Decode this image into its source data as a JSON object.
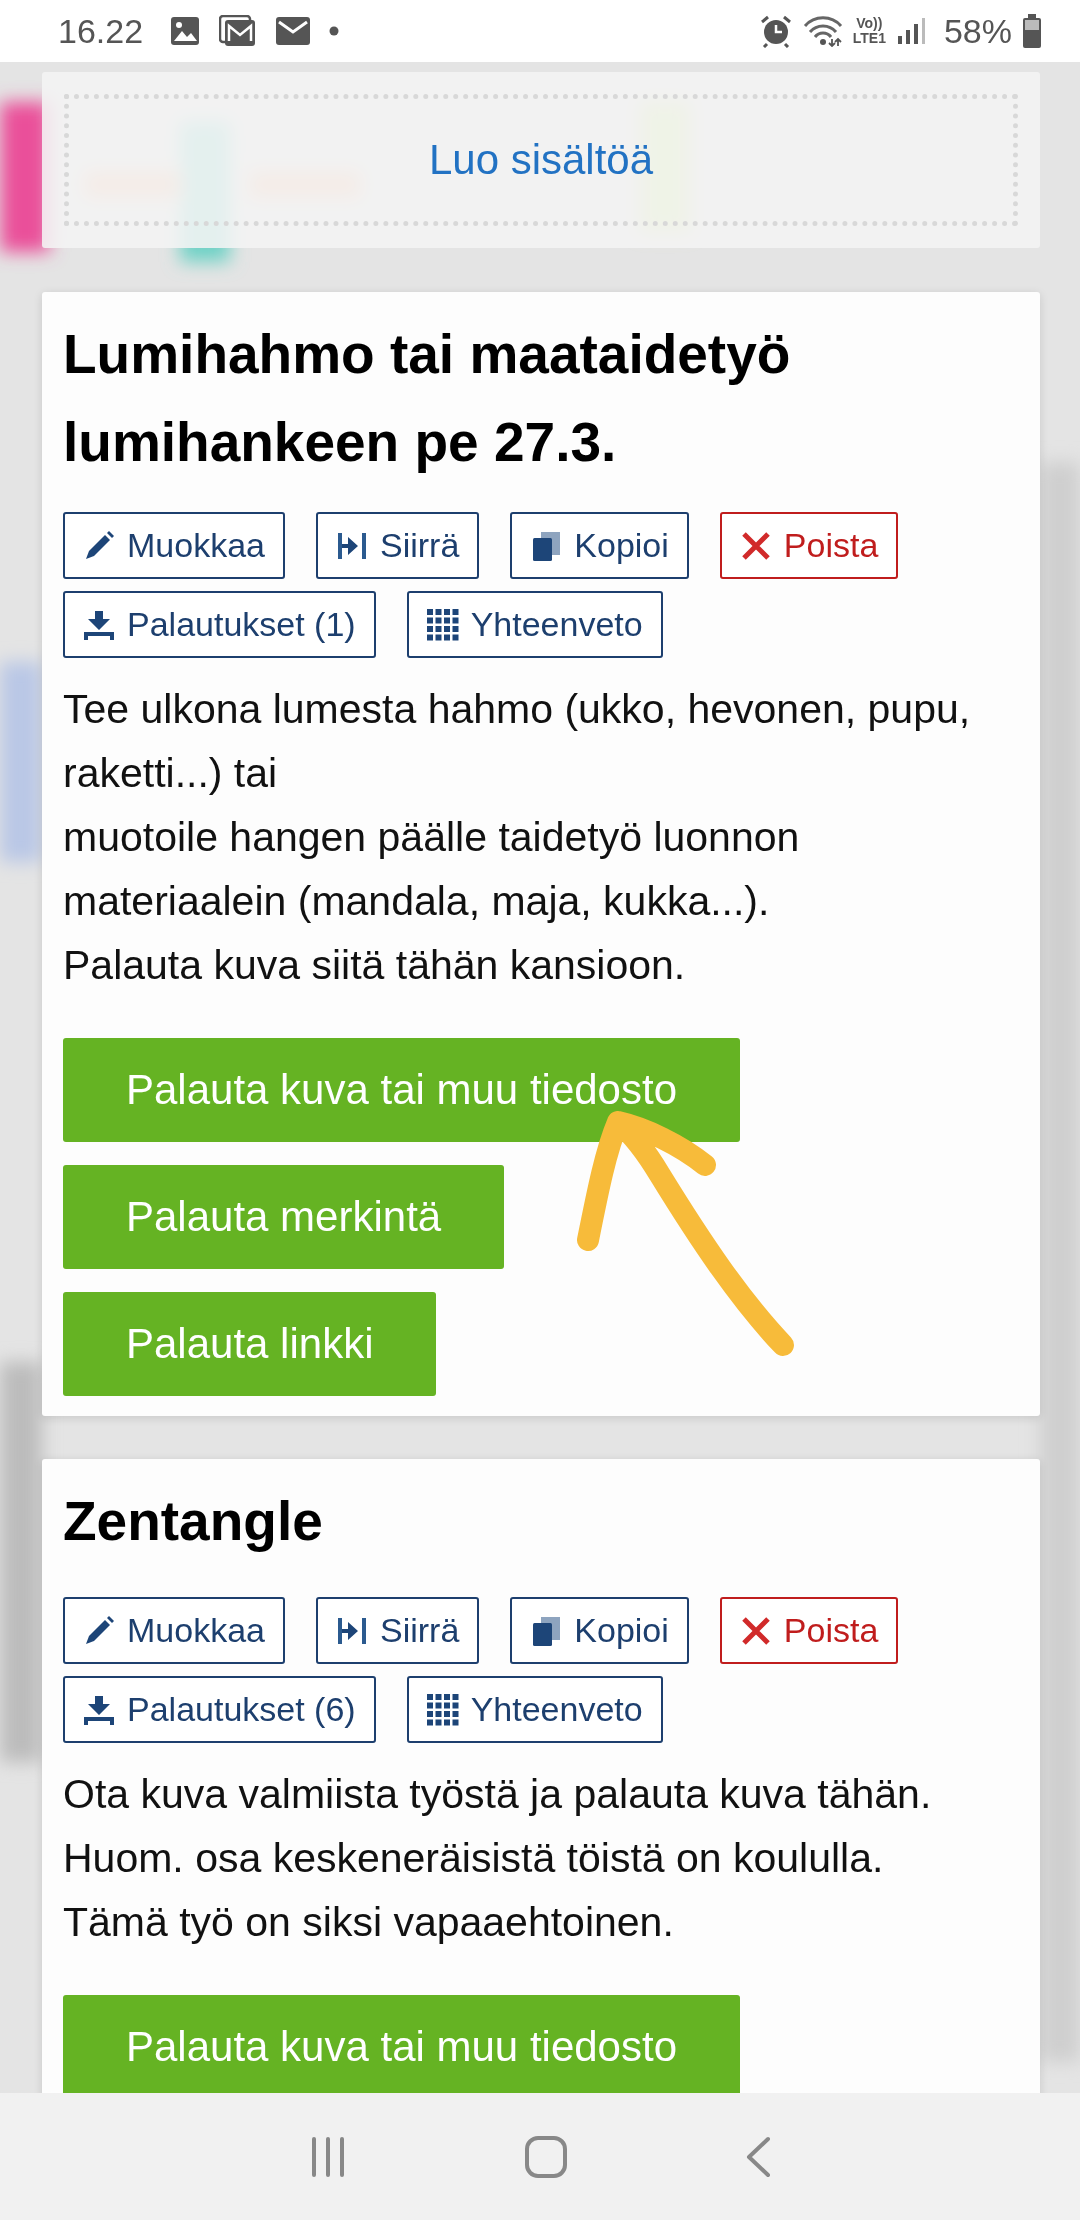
{
  "status_bar": {
    "time": "16.22",
    "network": [
      "Vo))",
      "LTE1"
    ],
    "battery": "58%"
  },
  "create_link": {
    "label": "Luo sisältöä"
  },
  "assignments": [
    {
      "title": "Lumihahmo tai maataidetyö lumihankeen pe 27.3.",
      "actions": [
        {
          "kind": "edit",
          "label": "Muokkaa"
        },
        {
          "kind": "move",
          "label": "Siirrä"
        },
        {
          "kind": "copy",
          "label": "Kopioi"
        },
        {
          "kind": "delete",
          "label": "Poista"
        },
        {
          "kind": "submissions",
          "label": "Palautukset (1)"
        },
        {
          "kind": "summary",
          "label": "Yhteenveto"
        }
      ],
      "description": [
        "Tee ulkona lumesta hahmo (ukko, hevonen, pupu, raketti...) tai",
        "muotoile hangen päälle taidetyö luonnon materiaalein (mandala, maja, kukka...).",
        "Palauta kuva siitä tähän kansioon."
      ],
      "submit_buttons": [
        "Palauta kuva tai muu tiedosto",
        "Palauta merkintä",
        "Palauta linkki"
      ]
    },
    {
      "title": "Zentangle",
      "actions": [
        {
          "kind": "edit",
          "label": "Muokkaa"
        },
        {
          "kind": "move",
          "label": "Siirrä"
        },
        {
          "kind": "copy",
          "label": "Kopioi"
        },
        {
          "kind": "delete",
          "label": "Poista"
        },
        {
          "kind": "submissions",
          "label": "Palautukset (6)"
        },
        {
          "kind": "summary",
          "label": "Yhteenveto"
        }
      ],
      "description": [
        "Ota kuva valmiista työstä ja palauta kuva tähän.",
        "Huom. osa keskeneräisistä töistä on koululla.",
        "Tämä työ on siksi vapaaehtoinen."
      ],
      "submit_buttons": [
        "Palauta kuva tai muu tiedosto"
      ]
    }
  ]
}
